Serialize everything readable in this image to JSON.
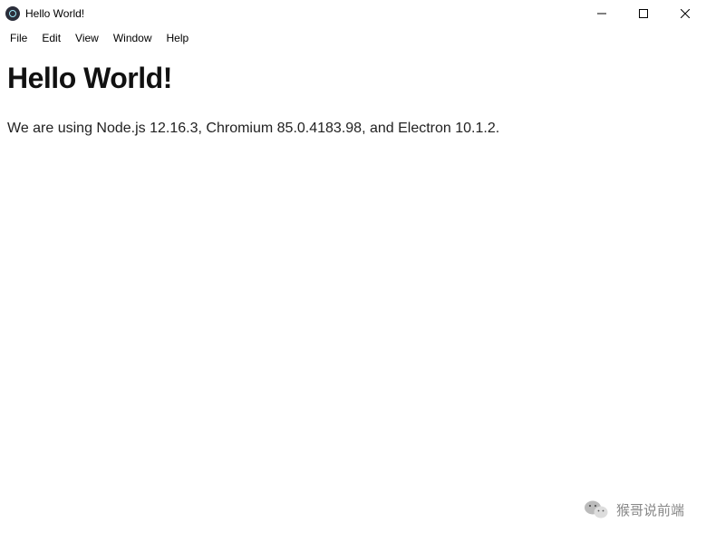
{
  "window": {
    "title": "Hello World!"
  },
  "menu": {
    "items": [
      {
        "label": "File"
      },
      {
        "label": "Edit"
      },
      {
        "label": "View"
      },
      {
        "label": "Window"
      },
      {
        "label": "Help"
      }
    ]
  },
  "content": {
    "heading": "Hello World!",
    "body_prefix": "We are using Node.js ",
    "node_version": "12.16.3",
    "body_mid1": ", Chromium ",
    "chromium_version": "85.0.4183.98",
    "body_mid2": ", and Electron ",
    "electron_version": "10.1.2",
    "body_suffix": "."
  },
  "watermark": {
    "text": "猴哥说前端"
  }
}
